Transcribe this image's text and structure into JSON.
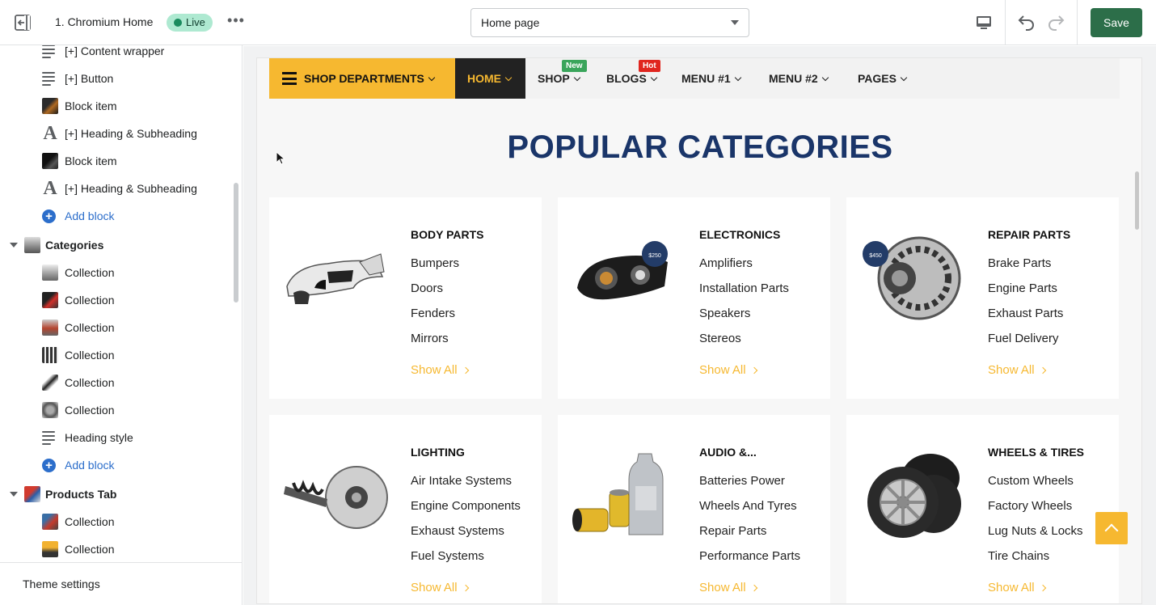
{
  "topbar": {
    "theme_name": "1. Chromium Home",
    "status": "Live",
    "more": "•••",
    "page_select": "Home page",
    "save_label": "Save"
  },
  "sidebar": {
    "rows": [
      {
        "label": "[+] Content wrapper",
        "icon": "lines-icon"
      },
      {
        "label": "[+] Button",
        "icon": "lines-icon"
      },
      {
        "label": "Block item",
        "icon": "image-thumb-icon"
      },
      {
        "label": "[+] Heading & Subheading",
        "icon": "text-A-icon"
      },
      {
        "label": "Block item",
        "icon": "image-thumb-icon"
      },
      {
        "label": "[+] Heading & Subheading",
        "icon": "text-A-icon"
      },
      {
        "label": "Add block",
        "icon": "plus-circle-icon"
      },
      {
        "label": "Categories",
        "icon": "section-thumb-icon"
      },
      {
        "label": "Collection",
        "icon": "image-thumb-icon"
      },
      {
        "label": "Collection",
        "icon": "image-thumb-icon"
      },
      {
        "label": "Collection",
        "icon": "image-thumb-icon"
      },
      {
        "label": "Collection",
        "icon": "image-thumb-icon"
      },
      {
        "label": "Collection",
        "icon": "image-thumb-icon"
      },
      {
        "label": "Collection",
        "icon": "image-thumb-icon"
      },
      {
        "label": "Heading style",
        "icon": "lines-icon"
      },
      {
        "label": "Add block",
        "icon": "plus-circle-icon"
      },
      {
        "label": "Products Tab",
        "icon": "section-thumb-icon"
      },
      {
        "label": "Collection",
        "icon": "image-thumb-icon"
      },
      {
        "label": "Collection",
        "icon": "image-thumb-icon"
      }
    ],
    "theme_settings": "Theme settings"
  },
  "preview": {
    "nav": {
      "departments": "SHOP DEPARTMENTS",
      "items": [
        {
          "label": "HOME",
          "badge": ""
        },
        {
          "label": "SHOP",
          "badge": "New"
        },
        {
          "label": "BLOGS",
          "badge": "Hot"
        },
        {
          "label": "MENU #1",
          "badge": ""
        },
        {
          "label": "MENU #2",
          "badge": ""
        },
        {
          "label": "PAGES",
          "badge": ""
        }
      ]
    },
    "heading": "POPULAR CATEGORIES",
    "show_all": "Show All",
    "categories": [
      {
        "title": "BODY PARTS",
        "links": [
          "Bumpers",
          "Doors",
          "Fenders",
          "Mirrors"
        ]
      },
      {
        "title": "ELECTRONICS",
        "links": [
          "Amplifiers",
          "Installation Parts",
          "Speakers",
          "Stereos"
        ]
      },
      {
        "title": "REPAIR PARTS",
        "links": [
          "Brake Parts",
          "Engine Parts",
          "Exhaust Parts",
          "Fuel Delivery"
        ]
      },
      {
        "title": "LIGHTING",
        "links": [
          "Air Intake Systems",
          "Engine Components",
          "Exhaust Systems",
          "Fuel Systems"
        ]
      },
      {
        "title": "AUDIO &...",
        "links": [
          "Batteries Power",
          "Wheels And Tyres",
          "Repair Parts",
          "Performance Parts"
        ]
      },
      {
        "title": "WHEELS & TIRES",
        "links": [
          "Custom Wheels",
          "Factory Wheels",
          "Lug Nuts & Locks",
          "Tire Chains"
        ]
      }
    ],
    "badge_new_color": "#3aa55b",
    "badge_hot_color": "#e0261f",
    "accent": "#f6b830",
    "heading_color": "#1a3569"
  }
}
